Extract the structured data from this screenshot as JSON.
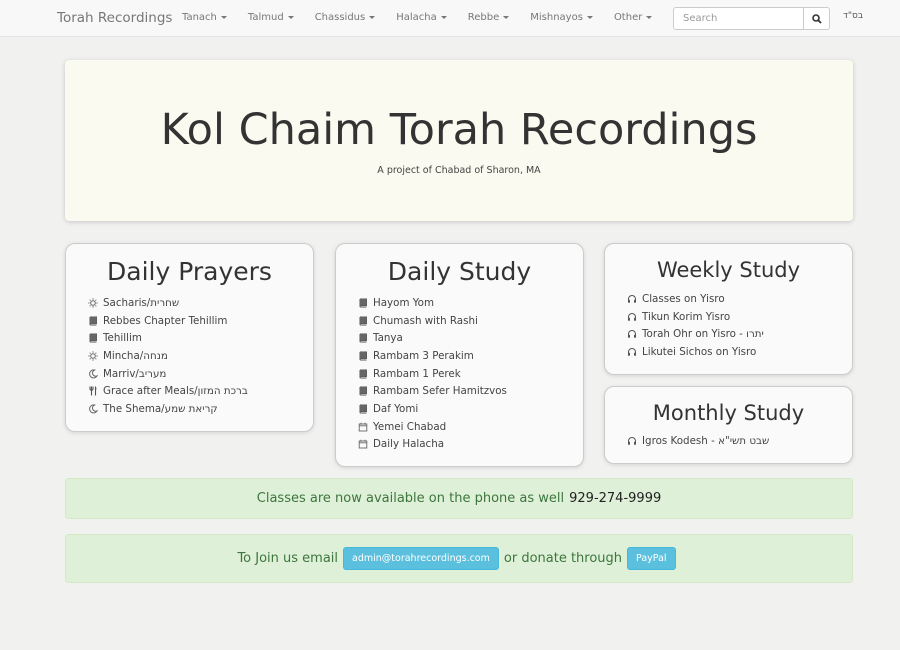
{
  "navbar": {
    "brand": "Torah Recordings",
    "menu": [
      "Tanach",
      "Talmud",
      "Chassidus",
      "Halacha",
      "Rebbe",
      "Mishnayos",
      "Other"
    ],
    "search_placeholder": "Search",
    "bsd": "בס\"ד"
  },
  "hero": {
    "title": "Kol Chaim Torah Recordings",
    "subtitle": "A project of Chabad of Sharon, MA"
  },
  "daily_prayers": {
    "title": "Daily Prayers",
    "items": [
      {
        "label": "Sacharis/שחרית",
        "icon": "sun-icon"
      },
      {
        "label": "Rebbes Chapter Tehillim",
        "icon": "book-icon"
      },
      {
        "label": "Tehillim",
        "icon": "book-icon"
      },
      {
        "label": "Mincha/מנחה",
        "icon": "sun-icon"
      },
      {
        "label": "Marriv/מעריב",
        "icon": "moon-icon"
      },
      {
        "label": "Grace after Meals/ברכת המזון",
        "icon": "cutlery-icon"
      },
      {
        "label": "The Shema/קריאת שמע",
        "icon": "moon-icon"
      }
    ]
  },
  "daily_study": {
    "title": "Daily Study",
    "items": [
      {
        "label": "Hayom Yom",
        "icon": "book-icon"
      },
      {
        "label": "Chumash with Rashi",
        "icon": "book-icon"
      },
      {
        "label": "Tanya",
        "icon": "book-icon"
      },
      {
        "label": "Rambam 3 Perakim",
        "icon": "book-icon"
      },
      {
        "label": "Rambam 1 Perek",
        "icon": "book-icon"
      },
      {
        "label": "Rambam Sefer Hamitzvos",
        "icon": "book-icon"
      },
      {
        "label": "Daf Yomi",
        "icon": "book-icon"
      },
      {
        "label": "Yemei Chabad",
        "icon": "calendar-icon"
      },
      {
        "label": "Daily Halacha",
        "icon": "calendar-icon"
      }
    ]
  },
  "weekly_study": {
    "title": "Weekly Study",
    "items": [
      {
        "label": "Classes on Yisro",
        "icon": "headphones-icon"
      },
      {
        "label": "Tikun Korim Yisro",
        "icon": "headphones-icon"
      },
      {
        "label": "Torah Ohr on Yisro - יתרו",
        "icon": "headphones-icon"
      },
      {
        "label": "Likutei Sichos on Yisro",
        "icon": "headphones-icon"
      }
    ]
  },
  "monthly_study": {
    "title": "Monthly Study",
    "items": [
      {
        "label": "Igros Kodesh - שבט תשי\"א",
        "icon": "headphones-icon"
      }
    ]
  },
  "phone_alert": {
    "text": "Classes are now available on the phone as well",
    "phone": "929-274-9999"
  },
  "contact_alert": {
    "prefix": "To Join us email",
    "email_button": "admin@torahrecordings.com",
    "middle": "or donate through",
    "paypal_button": "PayPal"
  },
  "colors": {
    "alert_bg": "#dff0d8",
    "alert_text": "#3c763d",
    "button_info": "#5bc0de",
    "hero_bg": "#fafaf0"
  }
}
